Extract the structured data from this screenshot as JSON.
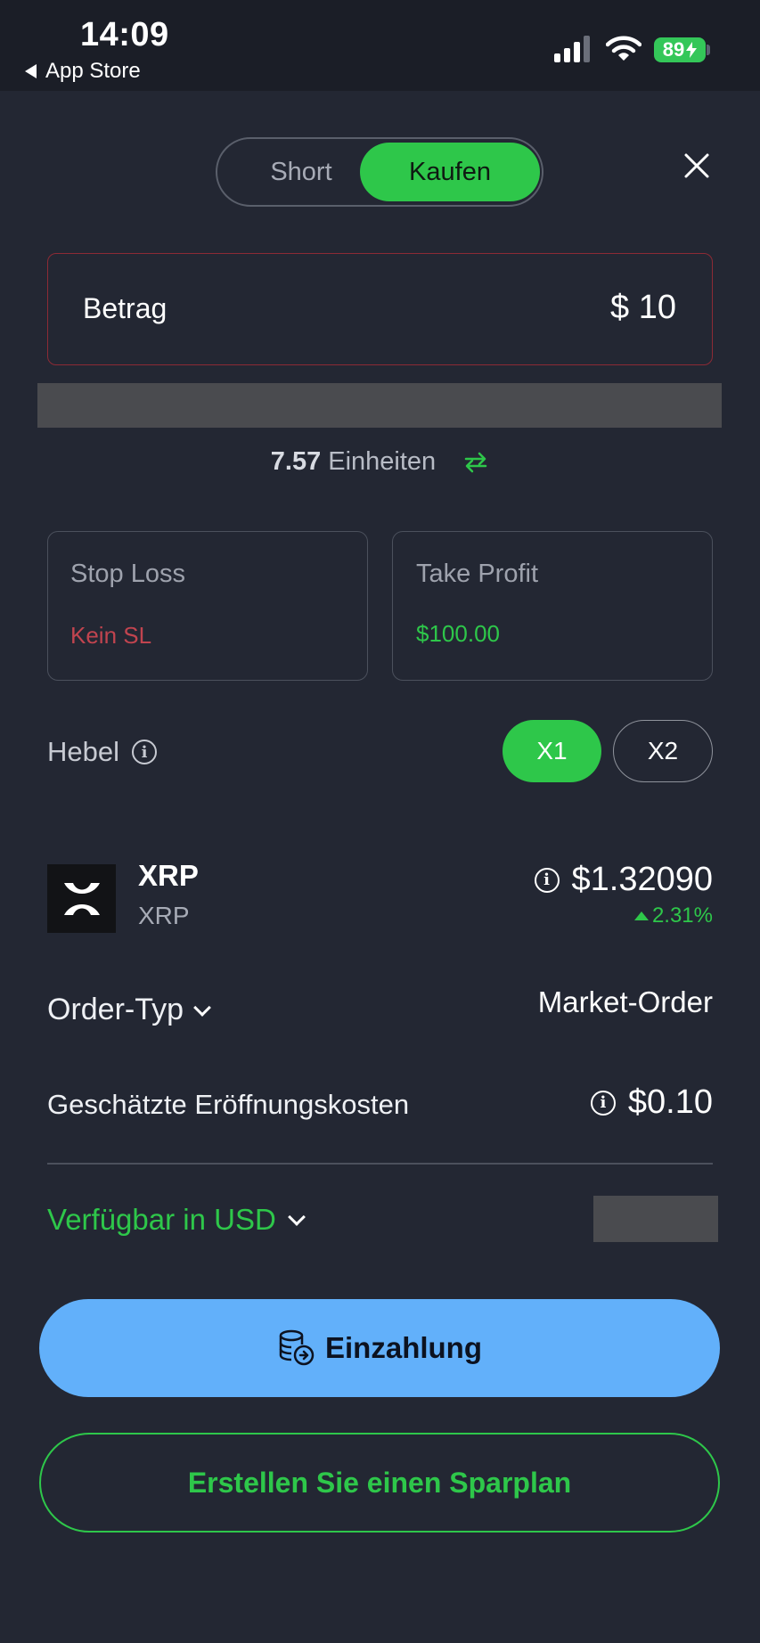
{
  "status_bar": {
    "time": "14:09",
    "back_label": "App Store",
    "battery": "89"
  },
  "toggle": {
    "short_label": "Short",
    "buy_label": "Kaufen",
    "active": "Kaufen"
  },
  "amount": {
    "label": "Betrag",
    "value": "$ 10"
  },
  "units": {
    "count": "7.57",
    "label": "Einheiten"
  },
  "stop_loss": {
    "title": "Stop Loss",
    "value": "Kein SL"
  },
  "take_profit": {
    "title": "Take Profit",
    "value": "$100.00"
  },
  "leverage": {
    "label": "Hebel",
    "options": [
      "X1",
      "X2"
    ],
    "selected": "X1"
  },
  "asset": {
    "name": "XRP",
    "symbol": "XRP",
    "price": "$1.32090",
    "change": "2.31%"
  },
  "order_type": {
    "label": "Order-Typ",
    "value": "Market-Order"
  },
  "cost": {
    "label": "Geschätzte Eröffnungskosten",
    "value": "$0.10"
  },
  "available": {
    "label": "Verfügbar in USD"
  },
  "buttons": {
    "deposit": "Einzahlung",
    "saveplan": "Erstellen Sie einen Sparplan"
  },
  "colors": {
    "background": "#232733",
    "green": "#2ec74a",
    "blue": "#62b0fa",
    "red": "#c1444f"
  },
  "icons": [
    "back-arrow-icon",
    "signal-icon",
    "wifi-icon",
    "battery-icon",
    "close-icon",
    "swap-icon",
    "info-icon",
    "xrp-logo",
    "chevron-down-icon",
    "deposit-coins-icon"
  ]
}
